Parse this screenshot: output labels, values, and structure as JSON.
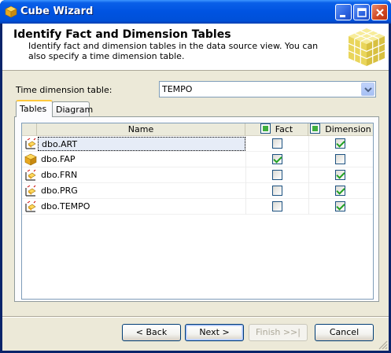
{
  "window": {
    "title": "Cube Wizard",
    "accent": "#0054e3"
  },
  "header": {
    "title": "Identify Fact and Dimension Tables",
    "description": "Identify fact and dimension tables in the data source view. You can also specify a time dimension table."
  },
  "time_dimension": {
    "label": "Time dimension table:",
    "selected": "TEMPO"
  },
  "tabs": [
    {
      "label": "Tables",
      "active": true
    },
    {
      "label": "Diagram",
      "active": false
    }
  ],
  "grid": {
    "columns": {
      "name": "Name",
      "fact": "Fact",
      "dimension": "Dimension"
    },
    "rows": [
      {
        "name": "dbo.ART",
        "icon": "dimension-table-icon",
        "fact": false,
        "dimension": true
      },
      {
        "name": "dbo.FAP",
        "icon": "fact-table-icon",
        "fact": true,
        "dimension": false
      },
      {
        "name": "dbo.FRN",
        "icon": "dimension-table-icon",
        "fact": false,
        "dimension": true
      },
      {
        "name": "dbo.PRG",
        "icon": "dimension-table-icon",
        "fact": false,
        "dimension": true
      },
      {
        "name": "dbo.TEMPO",
        "icon": "dimension-table-icon",
        "fact": false,
        "dimension": true
      }
    ]
  },
  "buttons": {
    "back": "< Back",
    "next": "Next >",
    "finish": "Finish >>|",
    "cancel": "Cancel"
  }
}
